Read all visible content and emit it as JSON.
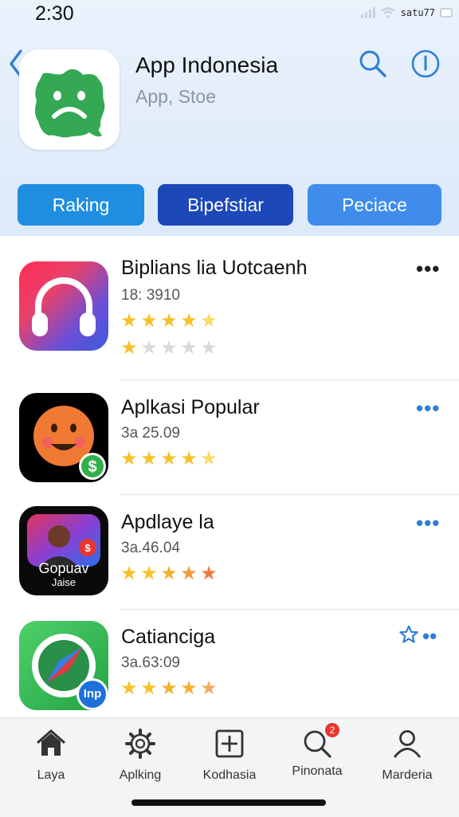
{
  "status_bar": {
    "time": "2:30",
    "carrier": "satu77"
  },
  "header": {
    "title": "App Indonesia",
    "subtitle": "App, Stoe"
  },
  "tabs": [
    {
      "label": "Raking"
    },
    {
      "label": "Bipefstiar"
    },
    {
      "label": "Peciace"
    }
  ],
  "apps": [
    {
      "title": "Biplians lia Uotcaenh",
      "meta": "18: 3910",
      "rating": 5,
      "second_rating": 1,
      "more_color": "#222222"
    },
    {
      "title": "Aplkasi Popular",
      "meta": "3a 25.09",
      "rating": 5,
      "more_color": "#2d7fd6"
    },
    {
      "title": "Apdlaye la",
      "meta": "3a.46.04",
      "rating": 5,
      "more_color": "#2d7fd6",
      "icon_text_1": "Gopuav",
      "icon_text_2": "Jaise"
    },
    {
      "title": "Catianciga",
      "meta": "3a.63:09",
      "rating": 5,
      "more_color": "#2d7fd6",
      "icon_badge": "Inp"
    }
  ],
  "tabbar": [
    {
      "label": "Laya",
      "icon": "home-icon"
    },
    {
      "label": "Aplking",
      "icon": "gear-icon"
    },
    {
      "label": "Kodhasia",
      "icon": "plus-box-icon"
    },
    {
      "label": "Pinonata",
      "icon": "search-icon",
      "badge": "2"
    },
    {
      "label": "Marderia",
      "icon": "person-icon"
    }
  ],
  "colors": {
    "accent": "#1f8ee0",
    "star": "#f6c228",
    "star_dim": "#d9d9d9"
  }
}
